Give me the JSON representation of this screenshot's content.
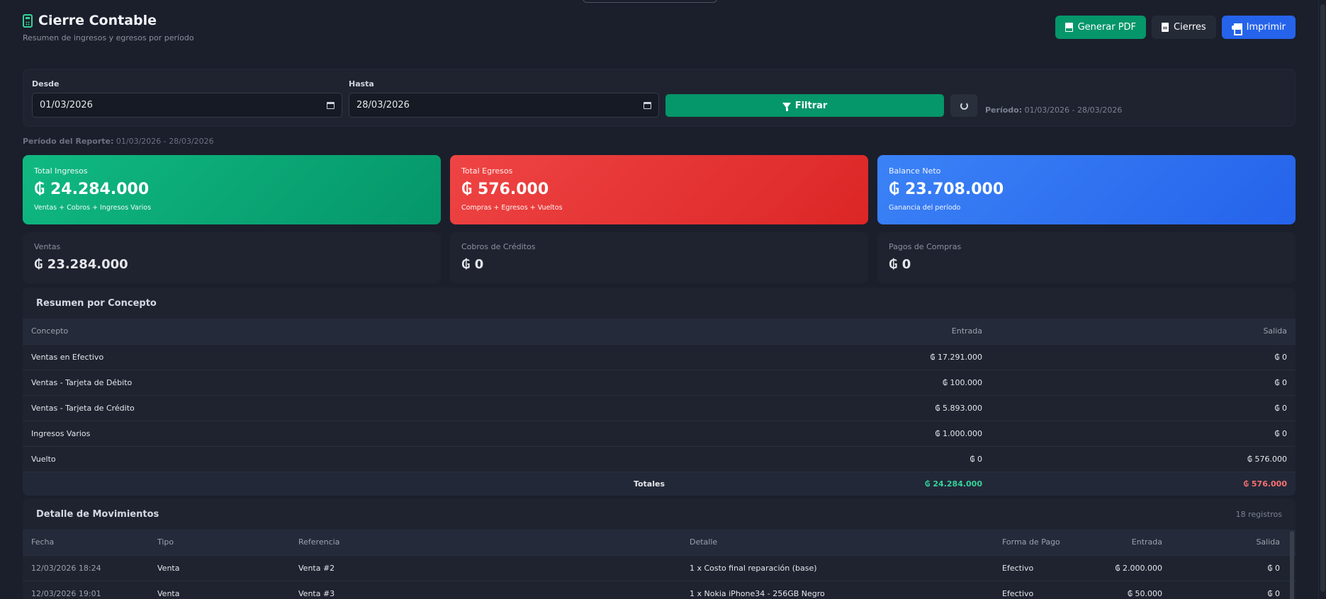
{
  "header": {
    "title": "Cierre Contable",
    "subtitle": "Resumen de ingresos y egresos por período",
    "buttons": {
      "pdf": "Generar PDF",
      "cierres": "Cierres",
      "print": "Imprimir"
    }
  },
  "filter": {
    "desde_label": "Desde",
    "desde_value": "01/03/2026",
    "hasta_label": "Hasta",
    "hasta_value": "28/03/2026",
    "filter_button": "Filtrar",
    "periodo_label": "Período:",
    "periodo_value": "01/03/2026 - 28/03/2026"
  },
  "report_period": {
    "label": "Período del Reporte:",
    "value": "01/03/2026 - 28/03/2026"
  },
  "kpis": [
    {
      "label": "Total Ingresos",
      "value": "₲ 24.284.000",
      "note": "Ventas + Cobros + Ingresos Varios",
      "color": "#10b981"
    },
    {
      "label": "Total Egresos",
      "value": "₲ 576.000",
      "note": "Compras + Egresos + Vueltos",
      "color": "#ef4444"
    },
    {
      "label": "Balance Neto",
      "value": "₲ 23.708.000",
      "note": "Ganancia del período",
      "color": "#3b82f6"
    }
  ],
  "subkpis": [
    {
      "label": "Ventas",
      "value": "₲ 23.284.000"
    },
    {
      "label": "Cobros de Créditos",
      "value": "₲ 0"
    },
    {
      "label": "Pagos de Compras",
      "value": "₲ 0"
    }
  ],
  "resumen": {
    "title": "Resumen por Concepto",
    "headers": [
      "Concepto",
      "Entrada",
      "Salida"
    ],
    "rows": [
      [
        "Ventas en Efectivo",
        "₲ 17.291.000",
        "₲ 0"
      ],
      [
        "Ventas - Tarjeta de Débito",
        "₲ 100.000",
        "₲ 0"
      ],
      [
        "Ventas - Tarjeta de Crédito",
        "₲ 5.893.000",
        "₲ 0"
      ],
      [
        "Ingresos Varios",
        "₲ 1.000.000",
        "₲ 0"
      ],
      [
        "Vuelto",
        "₲ 0",
        "₲ 576.000"
      ]
    ],
    "totals": {
      "label": "Totales",
      "entrada": "₲ 24.284.000",
      "salida": "₲ 576.000"
    }
  },
  "movimientos": {
    "title": "Detalle de Movimientos",
    "count": "18 registros",
    "headers": [
      "Fecha",
      "Tipo",
      "Referencia",
      "Detalle",
      "Forma de Pago",
      "Entrada",
      "Salida"
    ],
    "rows": [
      [
        "12/03/2026 18:24",
        "Venta",
        "Venta #2",
        "1 x Costo final reparación (base)",
        "Efectivo",
        "₲ 2.000.000",
        "₲ 0"
      ],
      [
        "12/03/2026 19:01",
        "Venta",
        "Venta #3",
        "1 x Nokia iPhone34 - 256GB Negro",
        "Efectivo",
        "₲ 50.000",
        "₲ 0"
      ]
    ]
  }
}
